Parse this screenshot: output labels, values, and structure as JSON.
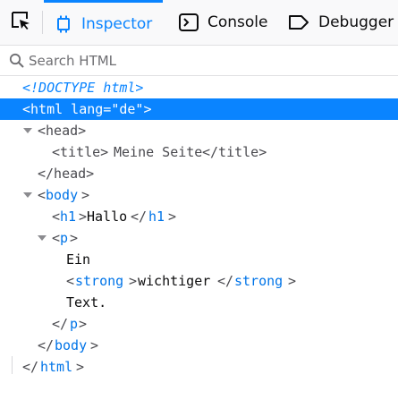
{
  "toolbar": {
    "tabs": [
      {
        "label": "Inspector",
        "icon": "inspector-icon",
        "active": true
      },
      {
        "label": "Console",
        "icon": "console-icon",
        "active": false
      },
      {
        "label": "Debugger",
        "icon": "debugger-icon",
        "active": false
      }
    ],
    "picker_icon": "element-picker-icon"
  },
  "search": {
    "placeholder": "Search HTML",
    "value": ""
  },
  "markup": {
    "doctype": "<!DOCTYPE html>",
    "html_open": "<html lang=\"de\">",
    "head_open": "<head>",
    "title_open": "<title>",
    "title_text": "Meine Seite",
    "title_close": "</title>",
    "head_close": "</head>",
    "body_open_lt": "<",
    "body_name": "body",
    "body_open_gt": ">",
    "h1_lt": "<",
    "h1_name": "h1",
    "h1_gt": ">",
    "h1_text": "Hallo",
    "h1_close_lt": "</",
    "h1_close_name": "h1",
    "h1_close_gt": ">",
    "p_lt": "<",
    "p_name": "p",
    "p_gt": ">",
    "p_text1": "Ein",
    "strong_lt": "<",
    "strong_name": "strong",
    "strong_gt": ">",
    "strong_text": "wichtiger",
    "strong_close_lt": "</",
    "strong_close_name": "strong",
    "strong_close_gt": ">",
    "p_text2": "Text.",
    "p_close_lt": "</",
    "p_close_name": "p",
    "p_close_gt": ">",
    "body_close_lt": "</",
    "body_close_name": "body",
    "body_close_gt": ">",
    "html_close_lt": "</",
    "html_close_name": "html",
    "html_close_gt": ">"
  },
  "colors": {
    "accent": "#0a84ff",
    "selection": "#0a84ff",
    "tag_name": "#0074e8"
  }
}
